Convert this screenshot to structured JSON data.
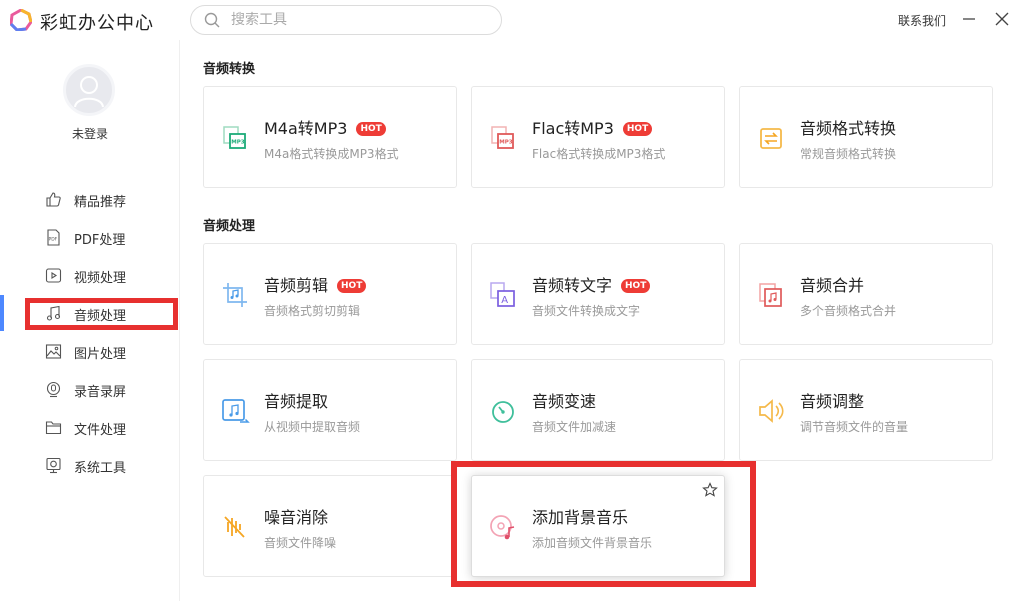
{
  "app": {
    "title": "彩虹办公中心"
  },
  "search": {
    "placeholder": "搜索工具"
  },
  "header": {
    "contact_label": "联系我们"
  },
  "user": {
    "status": "未登录"
  },
  "sidebar": {
    "items": [
      {
        "label": "精品推荐",
        "icon": "thumbs-up-icon"
      },
      {
        "label": "PDF处理",
        "icon": "pdf-icon"
      },
      {
        "label": "视频处理",
        "icon": "video-icon"
      },
      {
        "label": "音频处理",
        "icon": "music-note-icon",
        "active": true
      },
      {
        "label": "图片处理",
        "icon": "image-icon"
      },
      {
        "label": "录音录屏",
        "icon": "record-icon"
      },
      {
        "label": "文件处理",
        "icon": "folder-icon"
      },
      {
        "label": "系统工具",
        "icon": "system-tool-icon"
      }
    ]
  },
  "sections": [
    {
      "title": "音频转换",
      "cards": [
        {
          "title": "M4a转MP3",
          "desc": "M4a格式转换成MP3格式",
          "hot": "HOT",
          "icon": "m4a-to-mp3-icon"
        },
        {
          "title": "Flac转MP3",
          "desc": "Flac格式转换成MP3格式",
          "hot": "HOT",
          "icon": "flac-to-mp3-icon"
        },
        {
          "title": "音频格式转换",
          "desc": "常规音频格式转换",
          "icon": "audio-convert-icon"
        }
      ]
    },
    {
      "title": "音频处理",
      "cards": [
        {
          "title": "音频剪辑",
          "desc": "音频格式剪切剪辑",
          "hot": "HOT",
          "icon": "audio-crop-icon"
        },
        {
          "title": "音频转文字",
          "desc": "音频文件转换成文字",
          "hot": "HOT",
          "icon": "audio-to-text-icon"
        },
        {
          "title": "音频合并",
          "desc": "多个音频格式合并",
          "icon": "audio-merge-icon"
        },
        {
          "title": "音频提取",
          "desc": "从视频中提取音频",
          "icon": "audio-extract-icon"
        },
        {
          "title": "音频变速",
          "desc": "音频文件加减速",
          "icon": "speed-icon"
        },
        {
          "title": "音频调整",
          "desc": "调节音频文件的音量",
          "icon": "volume-icon"
        },
        {
          "title": "噪音消除",
          "desc": "音频文件降噪",
          "icon": "noise-reduction-icon"
        },
        {
          "title": "添加背景音乐",
          "desc": "添加音频文件背景音乐",
          "icon": "background-music-icon",
          "hovered": true
        }
      ]
    }
  ],
  "colors": {
    "accent": "#4d88ff",
    "hot_badge": "#ee3c36",
    "highlight": "#e7302f"
  }
}
